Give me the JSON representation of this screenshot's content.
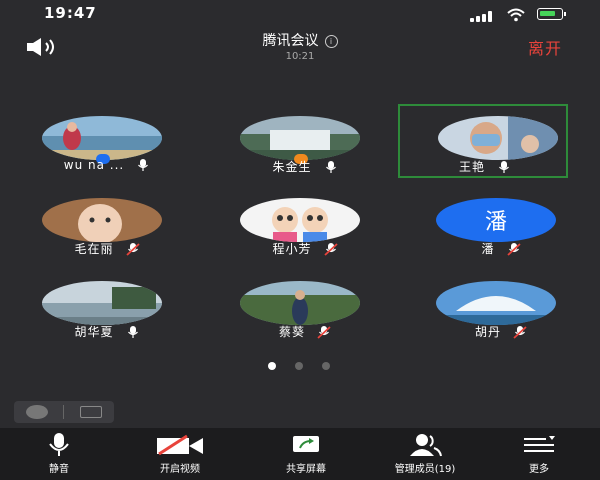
{
  "status_bar": {
    "time": "19:47"
  },
  "header": {
    "title": "腾讯会议",
    "timer": "10:21",
    "leave_label": "离开",
    "leave_color": "#e8433b"
  },
  "participants": [
    {
      "name": "wu na ...",
      "host_badge": "#1e6ef0",
      "mic": "on",
      "scene": "beach"
    },
    {
      "name": "朱金生",
      "host_badge": "#f08a1e",
      "mic": "on",
      "scene": "waterfall"
    },
    {
      "name": "王艳",
      "active": true,
      "mic": "on",
      "scene": "selfie"
    },
    {
      "name": "毛在丽",
      "mic": "muted",
      "scene": "baby"
    },
    {
      "name": "程小芳",
      "mic": "muted",
      "scene": "cartoon"
    },
    {
      "name": "潘",
      "avatar_text": "潘",
      "mic": "muted",
      "scene": "text"
    },
    {
      "name": "胡华夏",
      "mic": "on",
      "scene": "lake"
    },
    {
      "name": "蔡葵",
      "mic": "muted",
      "scene": "park"
    },
    {
      "name": "胡丹",
      "mic": "muted",
      "scene": "sky"
    }
  ],
  "pagination": {
    "pages": 3,
    "current": 1
  },
  "toolbar": [
    {
      "label": "静音",
      "icon": "mic-icon"
    },
    {
      "label": "开启视频",
      "icon": "camera-off-icon"
    },
    {
      "label": "共享屏幕",
      "icon": "share-screen-icon"
    },
    {
      "label": "管理成员(19)",
      "icon": "members-icon"
    },
    {
      "label": "更多",
      "icon": "more-icon"
    }
  ],
  "colors": {
    "background": "#2b2b2e",
    "active_border": "#2e8b3a",
    "toolbar_bg": "#1c1c1e",
    "mute_red": "#e8433b"
  }
}
